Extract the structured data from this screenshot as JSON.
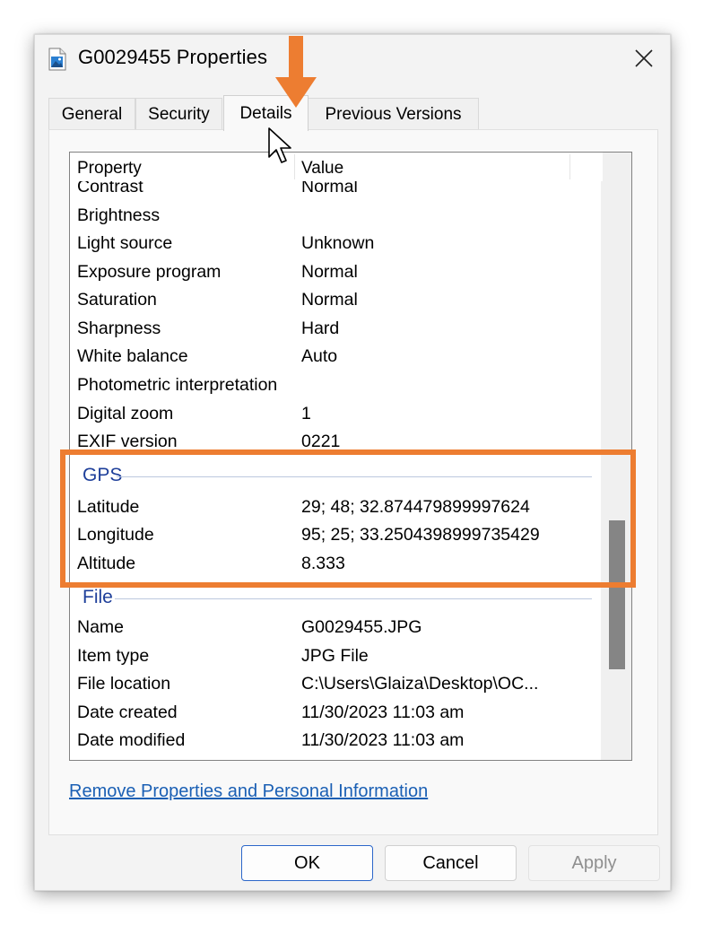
{
  "window": {
    "title": "G0029455 Properties",
    "file_icon": "image-file-icon",
    "close_icon": "close-icon"
  },
  "tabs": [
    {
      "label": "General",
      "active": false
    },
    {
      "label": "Security",
      "active": false
    },
    {
      "label": "Details",
      "active": true
    },
    {
      "label": "Previous Versions",
      "active": false
    }
  ],
  "columns": {
    "property": "Property",
    "value": "Value"
  },
  "rows": [
    {
      "property": "Contrast",
      "value": "Normal"
    },
    {
      "property": "Brightness",
      "value": ""
    },
    {
      "property": "Light source",
      "value": "Unknown"
    },
    {
      "property": "Exposure program",
      "value": "Normal"
    },
    {
      "property": "Saturation",
      "value": "Normal"
    },
    {
      "property": "Sharpness",
      "value": "Hard"
    },
    {
      "property": "White balance",
      "value": "Auto"
    },
    {
      "property": "Photometric interpretation",
      "value": ""
    },
    {
      "property": "Digital zoom",
      "value": "1"
    },
    {
      "property": "EXIF version",
      "value": "0221"
    }
  ],
  "gps": {
    "label": "GPS",
    "rows": [
      {
        "property": "Latitude",
        "value": "29; 48; 32.874479899997624"
      },
      {
        "property": "Longitude",
        "value": "95; 25; 33.2504398999735429"
      },
      {
        "property": "Altitude",
        "value": "8.333"
      }
    ]
  },
  "file": {
    "label": "File",
    "rows": [
      {
        "property": "Name",
        "value": "G0029455.JPG"
      },
      {
        "property": "Item type",
        "value": "JPG File"
      },
      {
        "property": "File location",
        "value": "C:\\Users\\Glaiza\\Desktop\\OC..."
      },
      {
        "property": "Date created",
        "value": "11/30/2023 11:03 am"
      },
      {
        "property": "Date modified",
        "value": "11/30/2023 11:03 am"
      }
    ]
  },
  "link": {
    "label": "Remove Properties and Personal Information"
  },
  "buttons": {
    "ok": "OK",
    "cancel": "Cancel",
    "apply": "Apply"
  },
  "annotation": {
    "color": "#ed7d31"
  },
  "colors": {
    "group_heading": "#1e3f9a",
    "link": "#1a5fb4",
    "ok_border": "#2b66c9"
  }
}
